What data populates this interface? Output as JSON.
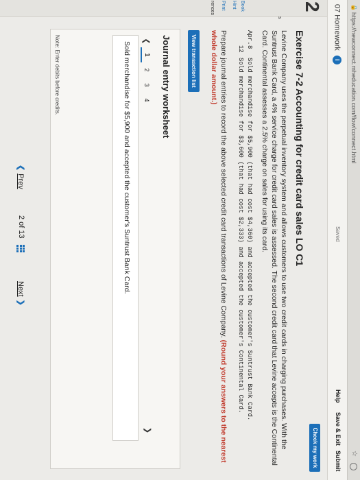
{
  "browser": {
    "url": "https://newconnect.mheducation.com/flow/connect.html"
  },
  "header": {
    "title": "07 Homework",
    "info_icon": "i",
    "saved": "Saved",
    "help": "Help",
    "save_exit": "Save & Exit",
    "submit": "Submit",
    "check_my_work": "Check my work"
  },
  "leftnav": {
    "question_number": "2",
    "items": [
      "Book",
      "Hint",
      "Print",
      "rences"
    ],
    "side_mark": "s"
  },
  "exercise": {
    "heading": "Exercise 7-2 Accounting for credit card sales LO C1",
    "intro": "Levine Company uses the perpetual inventory system and allows customers to use two credit cards in charging purchases. With the Suntrust Bank Card, a 4% service charge for credit card sales is assessed. The second credit card that Levine accepts is the Continental Card. Continental assesses a 2.5% charge on sales for using its card.",
    "transactions": [
      {
        "month": "Apr.",
        "day": "8",
        "text": "Sold merchandise for $5,900 (that had cost $4,360) and accepted the customer's Suntrust Bank Card."
      },
      {
        "month": "",
        "day": "12",
        "text": "Sold merchandise for $3,600 (that had cost $2,333) and accepted the customer's Continental Card."
      }
    ],
    "prepare_text": "Prepare journal entries to record the above selected credit card transactions of Levine Company.",
    "prepare_red": "(Round your answers to the nearest whole dollar amount.)",
    "view_transaction_list": "View transaction list"
  },
  "worksheet": {
    "title": "Journal entry worksheet",
    "pages": [
      "1",
      "2",
      "3",
      "4"
    ],
    "active_page": "1",
    "description": "Sold merchandise for $5,900 and accepted the customer's Suntrust Bank Card.",
    "note": "Note: Enter debits before credits."
  },
  "footer": {
    "prev": "Prev",
    "position": "2 of 13",
    "next": "Next"
  },
  "colors": {
    "accent": "#1c6fb8",
    "warning_text": "#c0392b"
  }
}
